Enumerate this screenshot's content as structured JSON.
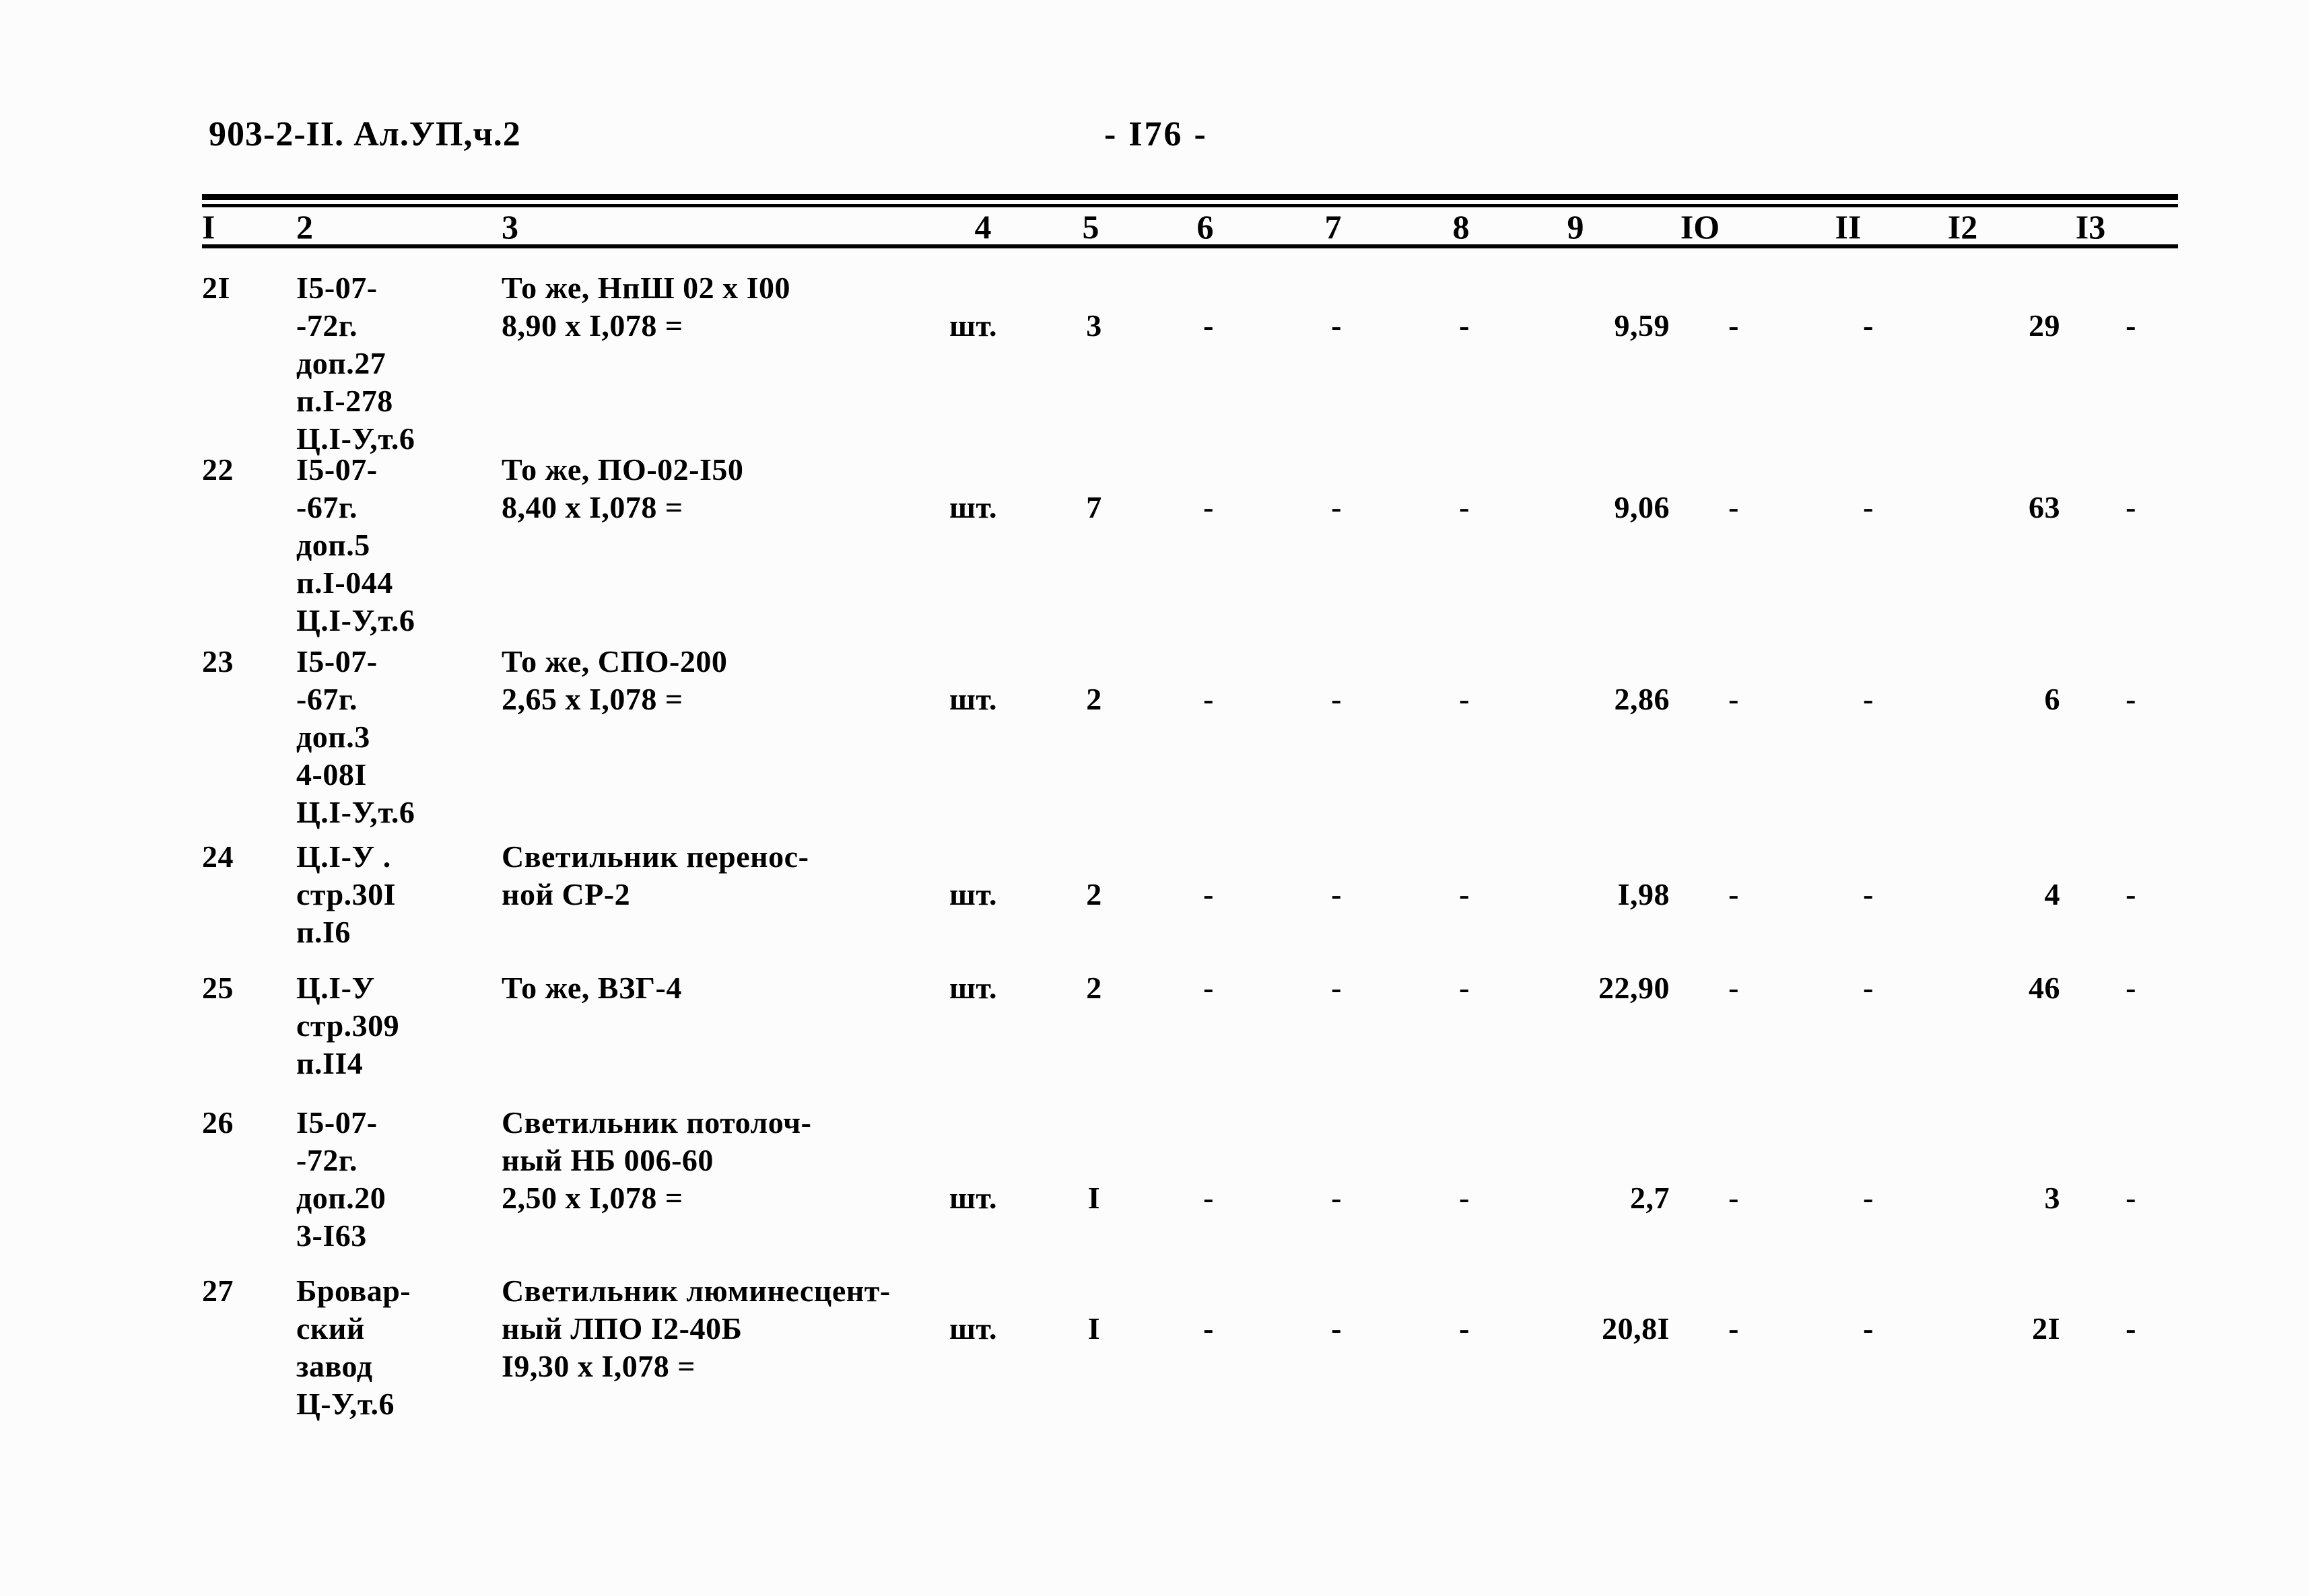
{
  "document": {
    "header_code": "903-2-II. Ал.УП,ч.2",
    "page_label": "- I76 -"
  },
  "table": {
    "column_headers": [
      "I",
      "2",
      "3",
      "4",
      "5",
      "6",
      "7",
      "8",
      "9",
      "IO",
      "II",
      "I2",
      "I3"
    ],
    "rows": [
      {
        "c1": "2I",
        "c2": "I5-07-\n-72г.\nдоп.27\nп.I-278\nЦ.I-У,т.6",
        "c3": "То же, НпШ 02 х I00\n8,90 х I,078 =",
        "c4": "шт.",
        "c5": "3",
        "c6": "-",
        "c7": "-",
        "c8": "-",
        "c9": "9,59",
        "c10": "-",
        "c11": "-",
        "c12": "29",
        "c13": "-"
      },
      {
        "c1": "22",
        "c2": "I5-07-\n-67г.\nдоп.5\nп.I-044\nЦ.I-У,т.6",
        "c3": "То же, ПО-02-I50\n8,40 х I,078 =",
        "c4": "шт.",
        "c5": "7",
        "c6": "-",
        "c7": "-",
        "c8": "-",
        "c9": "9,06",
        "c10": "-",
        "c11": "-",
        "c12": "63",
        "c13": "-"
      },
      {
        "c1": "23",
        "c2": "I5-07-\n-67г.\nдоп.3\n4-08I\nЦ.I-У,т.6",
        "c3": "То же, СПО-200\n2,65 х I,078 =",
        "c4": "шт.",
        "c5": "2",
        "c6": "-",
        "c7": "-",
        "c8": "-",
        "c9": "2,86",
        "c10": "-",
        "c11": "-",
        "c12": "6",
        "c13": "-"
      },
      {
        "c1": "24",
        "c2": "Ц.I-У .\nстр.30I\nп.I6",
        "c3": "Светильник перенос-\nной СР-2",
        "c4": "шт.",
        "c5": "2",
        "c6": "-",
        "c7": "-",
        "c8": "-",
        "c9": "I,98",
        "c10": "-",
        "c11": "-",
        "c12": "4",
        "c13": "-"
      },
      {
        "c1": "25",
        "c2": "Ц.I-У\nстр.309\nп.II4",
        "c3": "То же, ВЗГ-4",
        "c4": "шт.",
        "c5": "2",
        "c6": "-",
        "c7": "-",
        "c8": "-",
        "c9": "22,90",
        "c10": "-",
        "c11": "-",
        "c12": "46",
        "c13": "-"
      },
      {
        "c1": "26",
        "c2": "I5-07-\n-72г.\nдоп.20\n3-I63",
        "c3": "Светильник потолоч-\nный НБ 006-60\n2,50 х I,078 =",
        "c4": "шт.",
        "c5": "I",
        "c6": "-",
        "c7": "-",
        "c8": "-",
        "c9": "2,7",
        "c10": "-",
        "c11": "-",
        "c12": "3",
        "c13": "-"
      },
      {
        "c1": "27",
        "c2": "Бровар-\nский\nзавод\nЦ-У,т.6",
        "c3": "Светильник люминесцент-\nный ЛПО I2-40Б\nI9,30 х I,078 =",
        "c4": "шт.",
        "c5": "I",
        "c6": "-",
        "c7": "-",
        "c8": "-",
        "c9": "20,8I",
        "c10": "-",
        "c11": "-",
        "c12": "2I",
        "c13": "-"
      }
    ]
  }
}
